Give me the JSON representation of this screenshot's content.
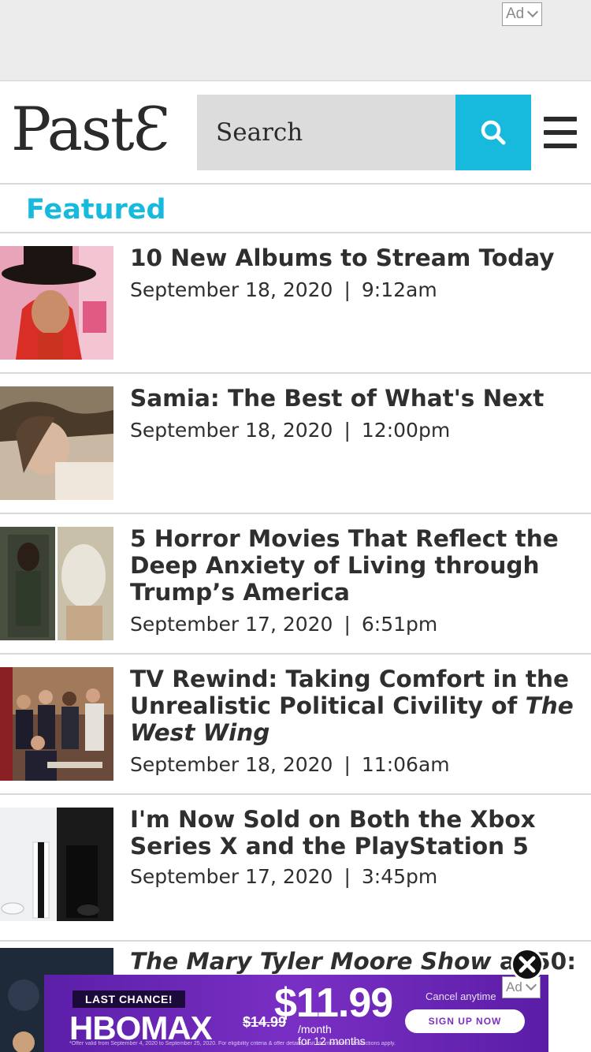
{
  "ads": {
    "top_choice_label": "Ad",
    "bottom_choice_label": "Ad",
    "banner": {
      "badge": "LAST CHANCE!",
      "brand": "HBOMAX",
      "old_price": "$14.99",
      "price": "$11.99",
      "price_suffix_1": "/month",
      "price_suffix_2": "for 12 months",
      "cancel_text": "Cancel anytime",
      "cta": "SIGN UP NOW",
      "fine_print": "*Offer valid from September 4, 2020 to September 25, 2020. For eligibility criteria & offer details, visit hbomax.com. Restrictions apply."
    }
  },
  "header": {
    "logo": "PastƐ",
    "search_placeholder": "Search"
  },
  "section": {
    "label": "Featured"
  },
  "articles": [
    {
      "title": "10 New Albums to Stream Today",
      "date": "September 18, 2020",
      "time": "9:12am"
    },
    {
      "title": "Samia: The Best of What's Next",
      "date": "September 18, 2020",
      "time": "12:00pm"
    },
    {
      "title": "5 Horror Movies That Reflect the Deep Anxiety of Living through Trump’s America",
      "date": "September 17, 2020",
      "time": "6:51pm"
    },
    {
      "title_prefix": "TV Rewind: Taking Comfort in the Unrealistic Political Civility of ",
      "title_italic": "The West Wing",
      "date": "September 18, 2020",
      "time": "11:06am"
    },
    {
      "title": "I'm Now Sold on Both the Xbox Series X and the PlayStation 5",
      "date": "September 17, 2020",
      "time": "3:45pm"
    },
    {
      "title_italic": "The Mary Tyler Moore Show",
      "title_suffix": " at 50:"
    }
  ],
  "colors": {
    "accent": "#17b9dd",
    "text": "#2f2f2f",
    "divider": "#d9d9d9"
  }
}
